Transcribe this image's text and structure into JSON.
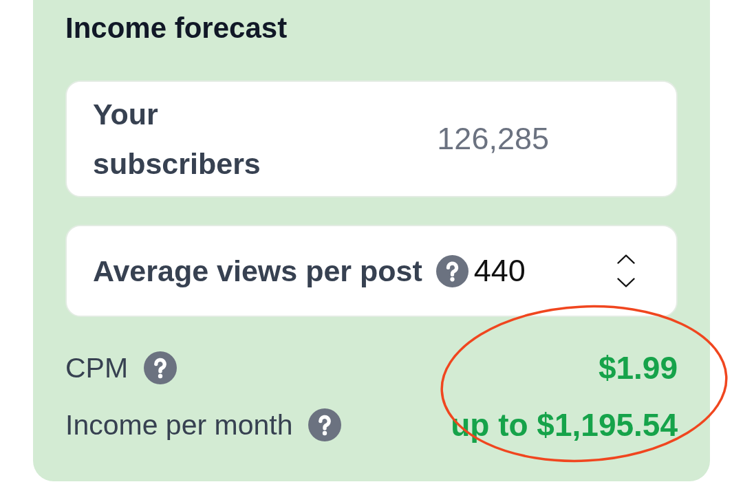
{
  "card": {
    "title": "Income forecast",
    "fields": [
      {
        "kind": "text",
        "label": "Your subscribers",
        "help": false,
        "placeholder": "126,285"
      },
      {
        "kind": "number",
        "label": "Average views per post",
        "help": true,
        "value": "440"
      }
    ],
    "stats": [
      {
        "label": "CPM",
        "help": true,
        "value": "$1.99"
      },
      {
        "label": "Income per month",
        "help": true,
        "value": "up to $1,195.54"
      }
    ]
  }
}
